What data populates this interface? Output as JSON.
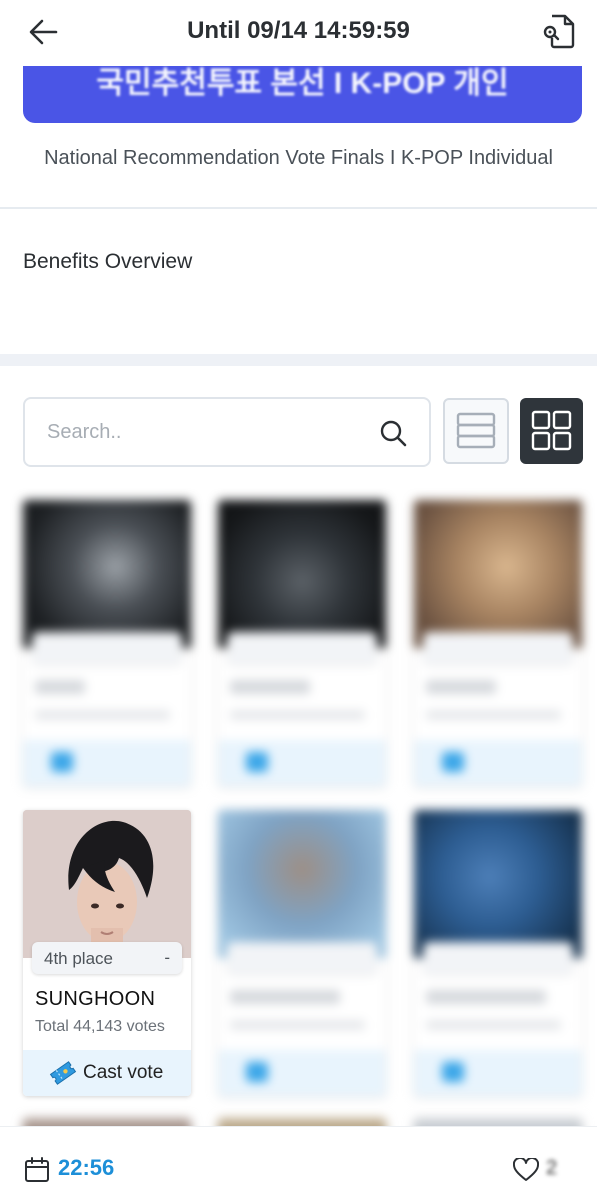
{
  "header": {
    "title": "Until 09/14 14:59:59"
  },
  "banner": {
    "text": "국민추천투표 본선 I K-POP 개인"
  },
  "subtitle": "National Recommendation Vote Finals I K-POP Individual",
  "benefits": {
    "label": "Benefits Overview"
  },
  "search": {
    "placeholder": "Search.."
  },
  "cards": [
    {
      "rank": "",
      "change": "",
      "name": "",
      "votes": "",
      "vote_label": "",
      "blurred": true
    },
    {
      "rank": "",
      "change": "",
      "name": "",
      "votes": "",
      "vote_label": "",
      "blurred": true
    },
    {
      "rank": "",
      "change": "",
      "name": "",
      "votes": "",
      "vote_label": "",
      "blurred": true
    },
    {
      "rank": "4th place",
      "change": "-",
      "name": "SUNGHOON",
      "votes": "Total 44,143 votes",
      "vote_label": "Cast vote",
      "blurred": false
    },
    {
      "rank": "",
      "change": "",
      "name": "",
      "votes": "",
      "vote_label": "",
      "blurred": true
    },
    {
      "rank": "",
      "change": "",
      "name": "",
      "votes": "",
      "vote_label": "",
      "blurred": true
    }
  ],
  "bottom_bar": {
    "timer": "22:56",
    "likes": "2"
  },
  "colors": {
    "banner": "#4a55e6",
    "accent": "#1d8fd8",
    "vote_button_bg": "#e8f4fd",
    "grid_toggle_active": "#2f353b"
  }
}
